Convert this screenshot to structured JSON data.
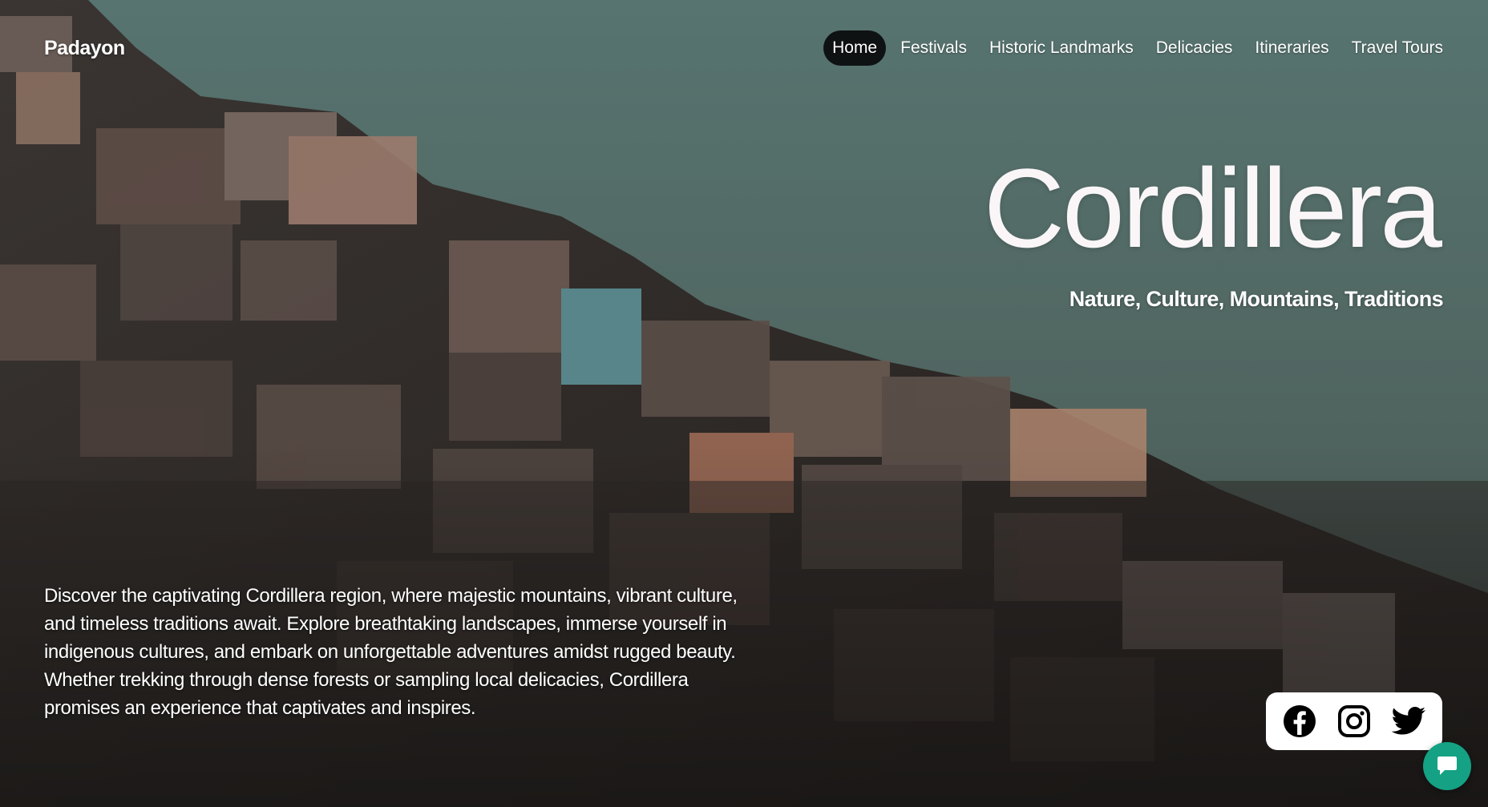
{
  "brand": {
    "name": "Padayon"
  },
  "nav": {
    "items": [
      {
        "label": "Home",
        "active": true
      },
      {
        "label": "Festivals",
        "active": false
      },
      {
        "label": "Historic Landmarks",
        "active": false
      },
      {
        "label": "Delicacies",
        "active": false
      },
      {
        "label": "Itineraries",
        "active": false
      },
      {
        "label": "Travel Tours",
        "active": false
      }
    ]
  },
  "hero": {
    "title": "Cordillera",
    "subtitle": "Nature, Culture, Mountains, Traditions",
    "description": "Discover the captivating Cordillera region, where majestic mountains, vibrant culture, and timeless traditions await. Explore breathtaking landscapes, immerse yourself in indigenous cultures, and embark on unforgettable adventures amidst rugged beauty. Whether trekking through dense forests or sampling local delicacies, Cordillera promises an experience that captivates and inspires."
  },
  "social": {
    "items": [
      {
        "icon": "facebook-icon"
      },
      {
        "icon": "instagram-icon"
      },
      {
        "icon": "twitter-icon"
      }
    ]
  },
  "chat": {
    "icon": "chat-bubble-icon"
  },
  "colors": {
    "sky": "#566f6b",
    "nav_active_bg": "#0f1212",
    "chat_button": "#14a184",
    "title": "#faf6f8"
  }
}
